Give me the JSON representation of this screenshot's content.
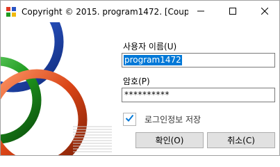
{
  "window": {
    "title": "Copyright © 2015. program1472. [Coup..."
  },
  "form": {
    "username_label": "사용자 이름(U)",
    "username_value": "program1472",
    "password_label": "암호(P)",
    "password_value": "**********",
    "remember_label": "로그인정보 저장",
    "remember_checked": true,
    "ok_label": "확인(O)",
    "cancel_label": "취소(C)"
  },
  "icons": {
    "app": "app-logo-icon",
    "minimize": "minimize-icon",
    "maximize": "maximize-icon",
    "close": "close-icon",
    "check": "checkmark-icon"
  },
  "colors": {
    "accent": "#0078d7",
    "ring_blue": "#2a54c4",
    "ring_green": "#1f9a1f",
    "ring_red": "#d94416",
    "button_face": "#e1e1e1"
  }
}
